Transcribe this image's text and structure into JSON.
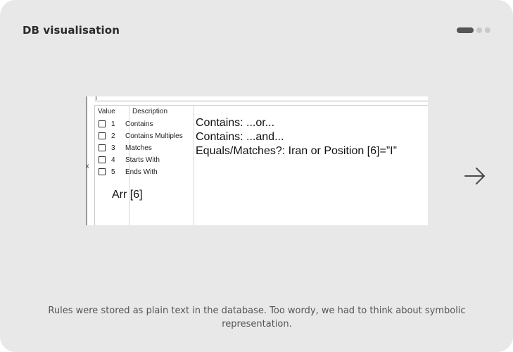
{
  "card": {
    "title": "DB visualisation",
    "pager": {
      "count": 3,
      "active_index": 0
    },
    "caption": "Rules were stored as plain text in the database. Too wordy, we had to think about symbolic representation."
  },
  "screenshot": {
    "headers": {
      "value": "Value",
      "description": "Description"
    },
    "rows": [
      {
        "value": "1",
        "description": "Contains",
        "checked": false
      },
      {
        "value": "2",
        "description": "Contains Multiples",
        "checked": false
      },
      {
        "value": "3",
        "description": "Matches",
        "checked": false
      },
      {
        "value": "4",
        "description": "Starts With",
        "checked": false
      },
      {
        "value": "5",
        "description": "Ends With",
        "checked": false
      }
    ],
    "notes": [
      "Contains: ...or...",
      "Contains: ...and...",
      "Equals/Matches?: Iran or  Position [6]=”I”"
    ],
    "arr_label": "Arr [6]",
    "rail_mark": "x"
  },
  "icons": {
    "next": "arrow-right-icon"
  },
  "colors": {
    "card_bg": "#e8e8e8",
    "pager_active": "#555555",
    "pager_inactive": "#c9c9c9"
  }
}
